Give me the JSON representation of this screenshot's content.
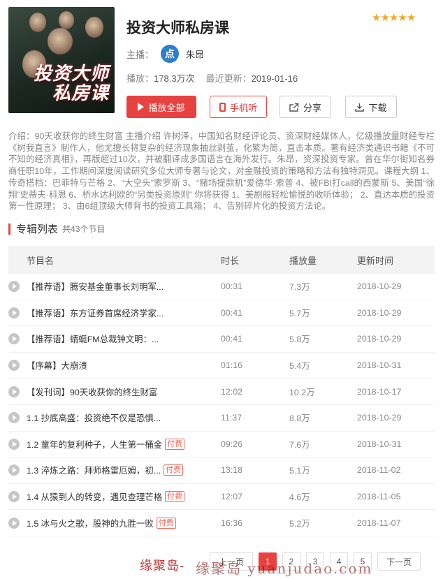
{
  "album": {
    "cover_text_line1": "投资大师",
    "cover_text_line2": "私房课",
    "title": "投资大师私房课",
    "rating_stars": "★★★★★",
    "host_label": "主播：",
    "host_avatar_char": "点",
    "host_name": "朱昂",
    "plays_label": "播放：",
    "plays_value": "178.3万次",
    "updated_label": "最近更新：",
    "updated_value": "2019-01-16"
  },
  "actions": {
    "play_all": "播放全部",
    "phone_listen": "手机听",
    "share": "分享",
    "download": "下载"
  },
  "intro": "介绍：90天收获你的终生财富 主播介绍 许树泽，中国知名财经评论员、资深财经媒体人，亿级播放量财经专栏《树我直言》制作人，他尤擅长将复杂的经济现象抽丝剥茧，化繁为简，直击本质。著有经济类通识书籍《不可不知的经济真相》，再版超过10次，并被翻译成多国语言在海外发行。朱昂，资深投资专家。曾在华尔街知名券商任职10年，工作期间深度阅读研究多位大师专著与论文，对金融投资的策略和方法有独特洞见。课程大纲 1、传奇搭档：巴菲特与芒格 2、“大空头”索罗斯 3、“赌场提款机”爱德华·索普 4、被FBI打call的西蒙斯 5、美国“徐翔”史蒂夫·科恩 6、桥水达利欧的“另类投资原则” 你将获得 1、美剧般轻松愉悦的收听体验； 2、直达本质的投资第一性原理； 3、由6组顶级大师背书的投资工具箱； 4、告别碎片化的投资方法论。",
  "section": {
    "title": "专辑列表",
    "count": "共43个节目"
  },
  "list_header": {
    "title": "节目名",
    "duration": "时长",
    "plays": "播放量",
    "updated": "更新时间"
  },
  "tracks": [
    {
      "title": "【推荐语】腾安基金董事长刘明军...",
      "paid": "",
      "duration": "00:31",
      "plays": "7.3万",
      "date": "2018-10-29"
    },
    {
      "title": "【推荐语】东方证券首席经济学家...",
      "paid": "",
      "duration": "00:41",
      "plays": "5.7万",
      "date": "2018-10-29"
    },
    {
      "title": "【推荐语】蜻蜓FM总裁钟文明：...",
      "paid": "",
      "duration": "00:41",
      "plays": "5.8万",
      "date": "2018-10-29"
    },
    {
      "title": "【序幕】大崩溃",
      "paid": "",
      "duration": "01:16",
      "plays": "5.4万",
      "date": "2018-10-31"
    },
    {
      "title": "【发刊词】90天收获你的终生财富",
      "paid": "",
      "duration": "12:02",
      "plays": "10.2万",
      "date": "2018-10-17"
    },
    {
      "title": "1.1 抄底高盛：投资绝不仅是恐惧...",
      "paid": "",
      "duration": "11:37",
      "plays": "8.8万",
      "date": "2018-10-29"
    },
    {
      "title": "1.2 童年的复利种子，人生第一桶金",
      "paid": "付费",
      "duration": "09:26",
      "plays": "7.6万",
      "date": "2018-10-31"
    },
    {
      "title": "1.3 淬炼之路：拜师格雷厄姆，初...",
      "paid": "付费",
      "duration": "13:18",
      "plays": "5.1万",
      "date": "2018-11-02"
    },
    {
      "title": "1.4 从猿到人的转变，遇见查理芒格",
      "paid": "付费",
      "duration": "12:07",
      "plays": "4.6万",
      "date": "2018-11-05"
    },
    {
      "title": "1.5 冰与火之歌，股神的九胜一败",
      "paid": "付费",
      "duration": "16:36",
      "plays": "5.2万",
      "date": "2018-11-07"
    }
  ],
  "pager": {
    "prev": "上一页",
    "pages": [
      "1",
      "2",
      "3",
      "4",
      "5"
    ],
    "active": "1",
    "next": "下一页"
  },
  "watermark": {
    "text1": "缘聚岛-",
    "text2": "缘聚岛 yuanjudao.com"
  },
  "colors": {
    "accent": "#e64340",
    "star": "#f5a623",
    "avatar": "#2f7ec9"
  }
}
